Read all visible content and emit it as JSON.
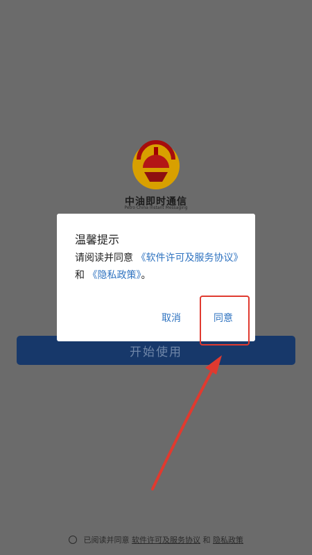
{
  "app": {
    "name_cn": "中油即时通信",
    "name_en": "Petro China Instant Messaging"
  },
  "start_button": {
    "label": "开始使用"
  },
  "dialog": {
    "title": "温馨提示",
    "text_prefix": "请阅读并同意",
    "link_software": "《软件许可及服务协议》",
    "text_and": "和",
    "link_privacy": "《隐私政策》",
    "text_end": "。",
    "cancel_label": "取消",
    "agree_label": "同意"
  },
  "agreement": {
    "prefix": "已阅读并同意",
    "link1": "软件许可及服务协议",
    "and": "和",
    "link2": "隐私政策"
  },
  "colors": {
    "overlay": "#6b6b6b",
    "link": "#2f73c0",
    "annotation": "#e03a2f"
  }
}
